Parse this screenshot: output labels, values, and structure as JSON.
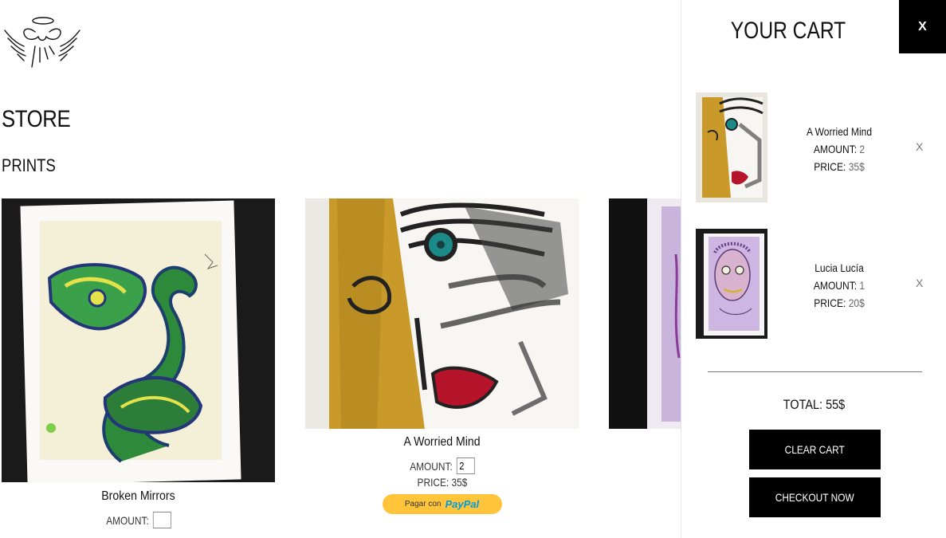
{
  "store": {
    "title": "STORE",
    "section": "PRINTS",
    "products": [
      {
        "name": "Broken Mirrors",
        "amount_label": "AMOUNT:",
        "amount_value": ""
      },
      {
        "name": "A Worried Mind",
        "amount_label": "AMOUNT:",
        "amount_value": "2",
        "price_label": "PRICE:",
        "price_value": "35$",
        "paypal_prefix": "Pagar con",
        "paypal_brand_a": "Pay",
        "paypal_brand_b": "Pal"
      }
    ]
  },
  "cart": {
    "title": "YOUR CART",
    "close_label": "X",
    "items": [
      {
        "name": "A Worried Mind",
        "amount_label": "AMOUNT:",
        "amount_value": "2",
        "price_label": "PRICE:",
        "price_value": "35$",
        "remove_label": "X"
      },
      {
        "name": "Lucia Lucía",
        "amount_label": "AMOUNT:",
        "amount_value": "1",
        "price_label": "PRICE:",
        "price_value": "20$",
        "remove_label": "X"
      }
    ],
    "total_label": "TOTAL:",
    "total_value": "55$",
    "clear_label": "CLEAR CART",
    "checkout_label": "CHECKOUT NOW"
  },
  "colors": {
    "paypal_yellow": "#ffc439",
    "paypal_navy": "#003087",
    "paypal_blue": "#009cde",
    "cart_button": "#000000"
  },
  "icons": {
    "logo": "angel-wings-logo"
  }
}
